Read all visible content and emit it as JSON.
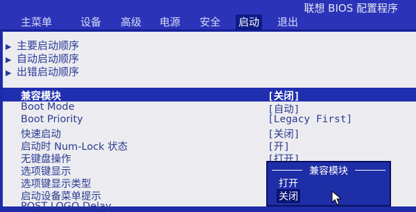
{
  "header": {
    "title": "联想 BIOS 配置程序"
  },
  "menu": {
    "tabs": [
      {
        "label": "主菜单"
      },
      {
        "label": "设备"
      },
      {
        "label": "高级"
      },
      {
        "label": "电源"
      },
      {
        "label": "安全"
      },
      {
        "label": "启动"
      },
      {
        "label": "退出"
      }
    ],
    "active_index": 5
  },
  "sections": [
    {
      "label": "主要启动顺序"
    },
    {
      "label": "自动启动顺序"
    },
    {
      "label": "出错启动顺序"
    }
  ],
  "settings": [
    {
      "label": "兼容模块",
      "value": "[关闭]"
    },
    {
      "label": "Boot Mode",
      "value": "[自动]"
    },
    {
      "label": "Boot Priority",
      "value": "[Legacy First]"
    },
    {
      "label": "快速启动",
      "value": "[关闭]"
    },
    {
      "label": "启动时 Num-Lock 状态",
      "value": "[开]"
    },
    {
      "label": "无键盘操作",
      "value": "[打开]"
    },
    {
      "label": "选项键显示",
      "value": ""
    },
    {
      "label": "选项键显示类型",
      "value": ""
    },
    {
      "label": "启动设备菜单提示",
      "value": ""
    },
    {
      "label": "POST LOGO Delay",
      "value": ""
    }
  ],
  "popup": {
    "title": "兼容模块",
    "options": [
      {
        "label": "打开"
      },
      {
        "label": "关闭"
      }
    ],
    "selected_index": 1
  },
  "colors": {
    "menu_bg": "#2b34b9",
    "panel_bg": "#ececf0",
    "highlight": "#1f2fb0",
    "text": "#2b3a8f"
  },
  "icons": [
    "triangle-right-icon",
    "mouse-cursor-icon"
  ]
}
